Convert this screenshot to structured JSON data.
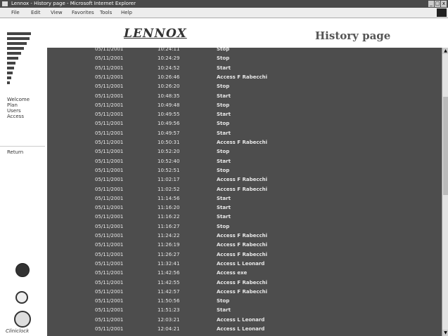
{
  "window": {
    "title": "Lennox - History page - Microsoft Internet Explorer",
    "controls": [
      "_",
      "□",
      "x"
    ]
  },
  "menubar": {
    "items": [
      "File",
      "Edit",
      "View",
      "Favorites",
      "Tools",
      "Help"
    ]
  },
  "sidebar": {
    "nav": [
      "Welcome",
      "Plan",
      "Users",
      "Access"
    ],
    "return_label": "Return",
    "bottom_label": "Cliniclock"
  },
  "header": {
    "brand": "LENNOX",
    "page_title": "History page"
  },
  "history": [
    {
      "date": "05/11/2001",
      "time": "10:24:11",
      "event": "Stop"
    },
    {
      "date": "05/11/2001",
      "time": "10:24:29",
      "event": "Stop"
    },
    {
      "date": "05/11/2001",
      "time": "10:24:52",
      "event": "Start"
    },
    {
      "date": "05/11/2001",
      "time": "10:26:46",
      "event": "Access F Rabecchi"
    },
    {
      "date": "05/11/2001",
      "time": "10:26:20",
      "event": "Stop"
    },
    {
      "date": "05/11/2001",
      "time": "10:48:35",
      "event": "Start"
    },
    {
      "date": "05/11/2001",
      "time": "10:49:48",
      "event": "Stop"
    },
    {
      "date": "05/11/2001",
      "time": "10:49:55",
      "event": "Start"
    },
    {
      "date": "05/11/2001",
      "time": "10:49:56",
      "event": "Stop"
    },
    {
      "date": "05/11/2001",
      "time": "10:49:57",
      "event": "Start"
    },
    {
      "date": "05/11/2001",
      "time": "10:50:31",
      "event": "Access F Rabecchi"
    },
    {
      "date": "05/11/2001",
      "time": "10:52:20",
      "event": "Stop"
    },
    {
      "date": "05/11/2001",
      "time": "10:52:40",
      "event": "Start"
    },
    {
      "date": "05/11/2001",
      "time": "10:52:51",
      "event": "Stop"
    },
    {
      "date": "05/11/2001",
      "time": "11:02:17",
      "event": "Access F Rabecchi"
    },
    {
      "date": "05/11/2001",
      "time": "11:02:52",
      "event": "Access F Rabecchi"
    },
    {
      "date": "05/11/2001",
      "time": "11:14:56",
      "event": "Start"
    },
    {
      "date": "05/11/2001",
      "time": "11:16:20",
      "event": "Start"
    },
    {
      "date": "05/11/2001",
      "time": "11:16:22",
      "event": "Start"
    },
    {
      "date": "05/11/2001",
      "time": "11:16:27",
      "event": "Stop"
    },
    {
      "date": "05/11/2001",
      "time": "11:24:22",
      "event": "Access F Rabecchi"
    },
    {
      "date": "05/11/2001",
      "time": "11:26:19",
      "event": "Access F Rabecchi"
    },
    {
      "date": "05/11/2001",
      "time": "11:26:27",
      "event": "Access F Rabecchi"
    },
    {
      "date": "05/11/2001",
      "time": "11:32:41",
      "event": "Access L Leonard"
    },
    {
      "date": "05/11/2001",
      "time": "11:42:56",
      "event": "Access exe"
    },
    {
      "date": "05/11/2001",
      "time": "11:42:55",
      "event": "Access F Rabecchi"
    },
    {
      "date": "05/11/2001",
      "time": "11:42:57",
      "event": "Access F Rabecchi"
    },
    {
      "date": "05/11/2001",
      "time": "11:50:56",
      "event": "Stop"
    },
    {
      "date": "05/11/2001",
      "time": "11:51:23",
      "event": "Start"
    },
    {
      "date": "05/11/2001",
      "time": "12:03:21",
      "event": "Access L Leonard"
    },
    {
      "date": "05/11/2001",
      "time": "12:04:21",
      "event": "Access L Leonard"
    }
  ]
}
